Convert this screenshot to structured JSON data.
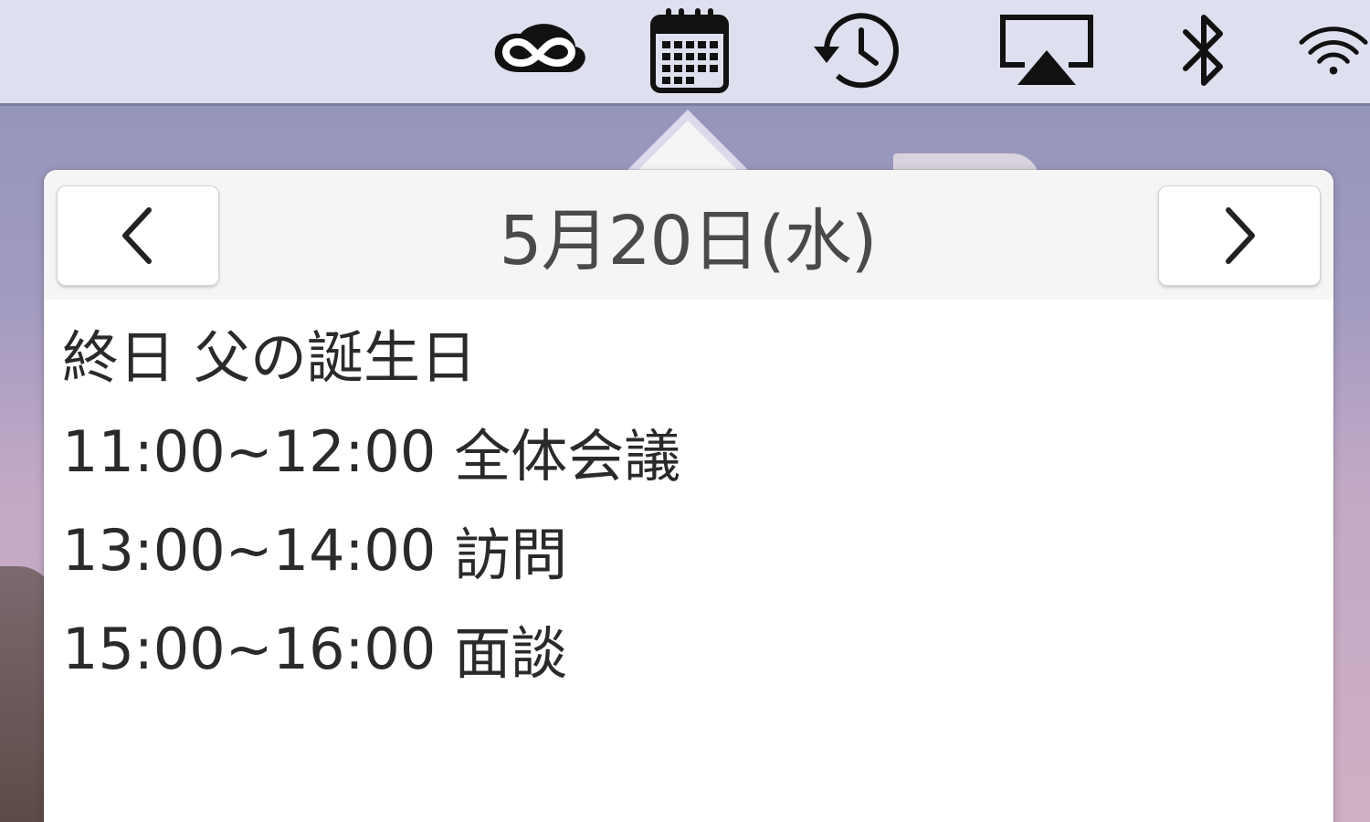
{
  "menubar": {
    "icons": [
      {
        "name": "creative-cloud-icon"
      },
      {
        "name": "calendar-icon"
      },
      {
        "name": "time-machine-icon"
      },
      {
        "name": "airplay-icon"
      },
      {
        "name": "bluetooth-icon"
      },
      {
        "name": "wifi-icon"
      }
    ]
  },
  "popover": {
    "date_label": "5月20日(水)",
    "prev_icon": "chevron-left-icon",
    "next_icon": "chevron-right-icon",
    "events": [
      {
        "time": "終日",
        "title": "父の誕生日"
      },
      {
        "time": "11:00~12:00",
        "title": "全体会議"
      },
      {
        "time": "13:00~14:00",
        "title": "訪問"
      },
      {
        "time": "15:00~16:00",
        "title": "面談"
      }
    ]
  }
}
